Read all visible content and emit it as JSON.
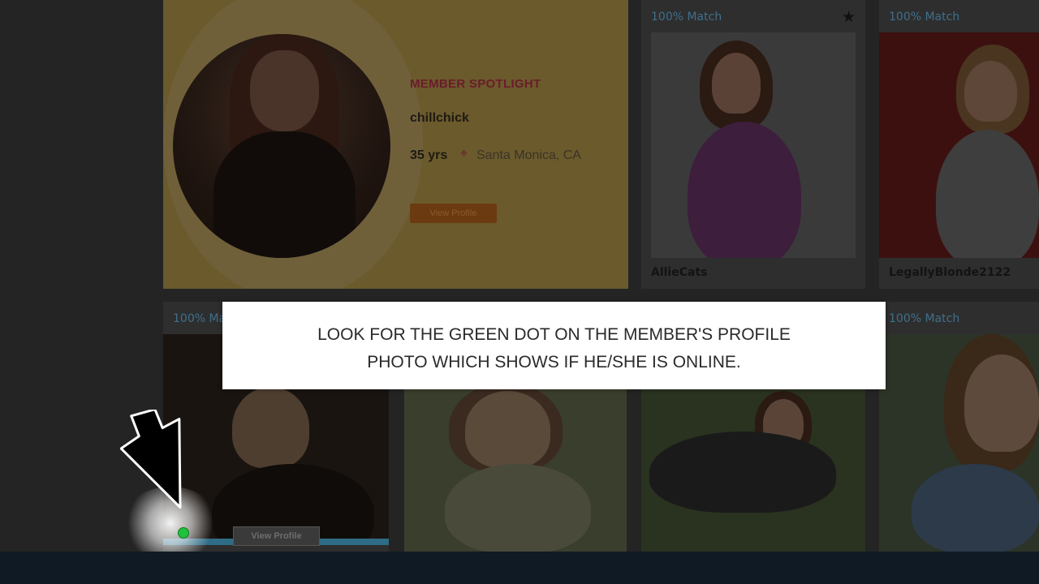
{
  "spotlight": {
    "title": "MEMBER SPOTLIGHT",
    "username": "chillchick",
    "age": "35 yrs",
    "location": "Santa Monica, CA",
    "button_label": "View Profile",
    "pin_icon": "location-pin-icon"
  },
  "cards": [
    {
      "match": "100% Match",
      "name": "AllieCats",
      "starred": true
    },
    {
      "match": "100% Match",
      "name": "LegallyBlonde2122"
    },
    {
      "match": "100% Ma"
    },
    {
      "match": "100% Match"
    }
  ],
  "online_card": {
    "button_label": "View Profile"
  },
  "tooltip": {
    "line1": "LOOK FOR THE GREEN DOT ON THE MEMBER'S PROFILE",
    "line2": "PHOTO WHICH SHOWS IF HE/SHE IS ONLINE."
  },
  "colors": {
    "online_dot": "#1fc23a",
    "spotlight_accent": "#e8254a",
    "match_label": "#4a9fd0"
  }
}
